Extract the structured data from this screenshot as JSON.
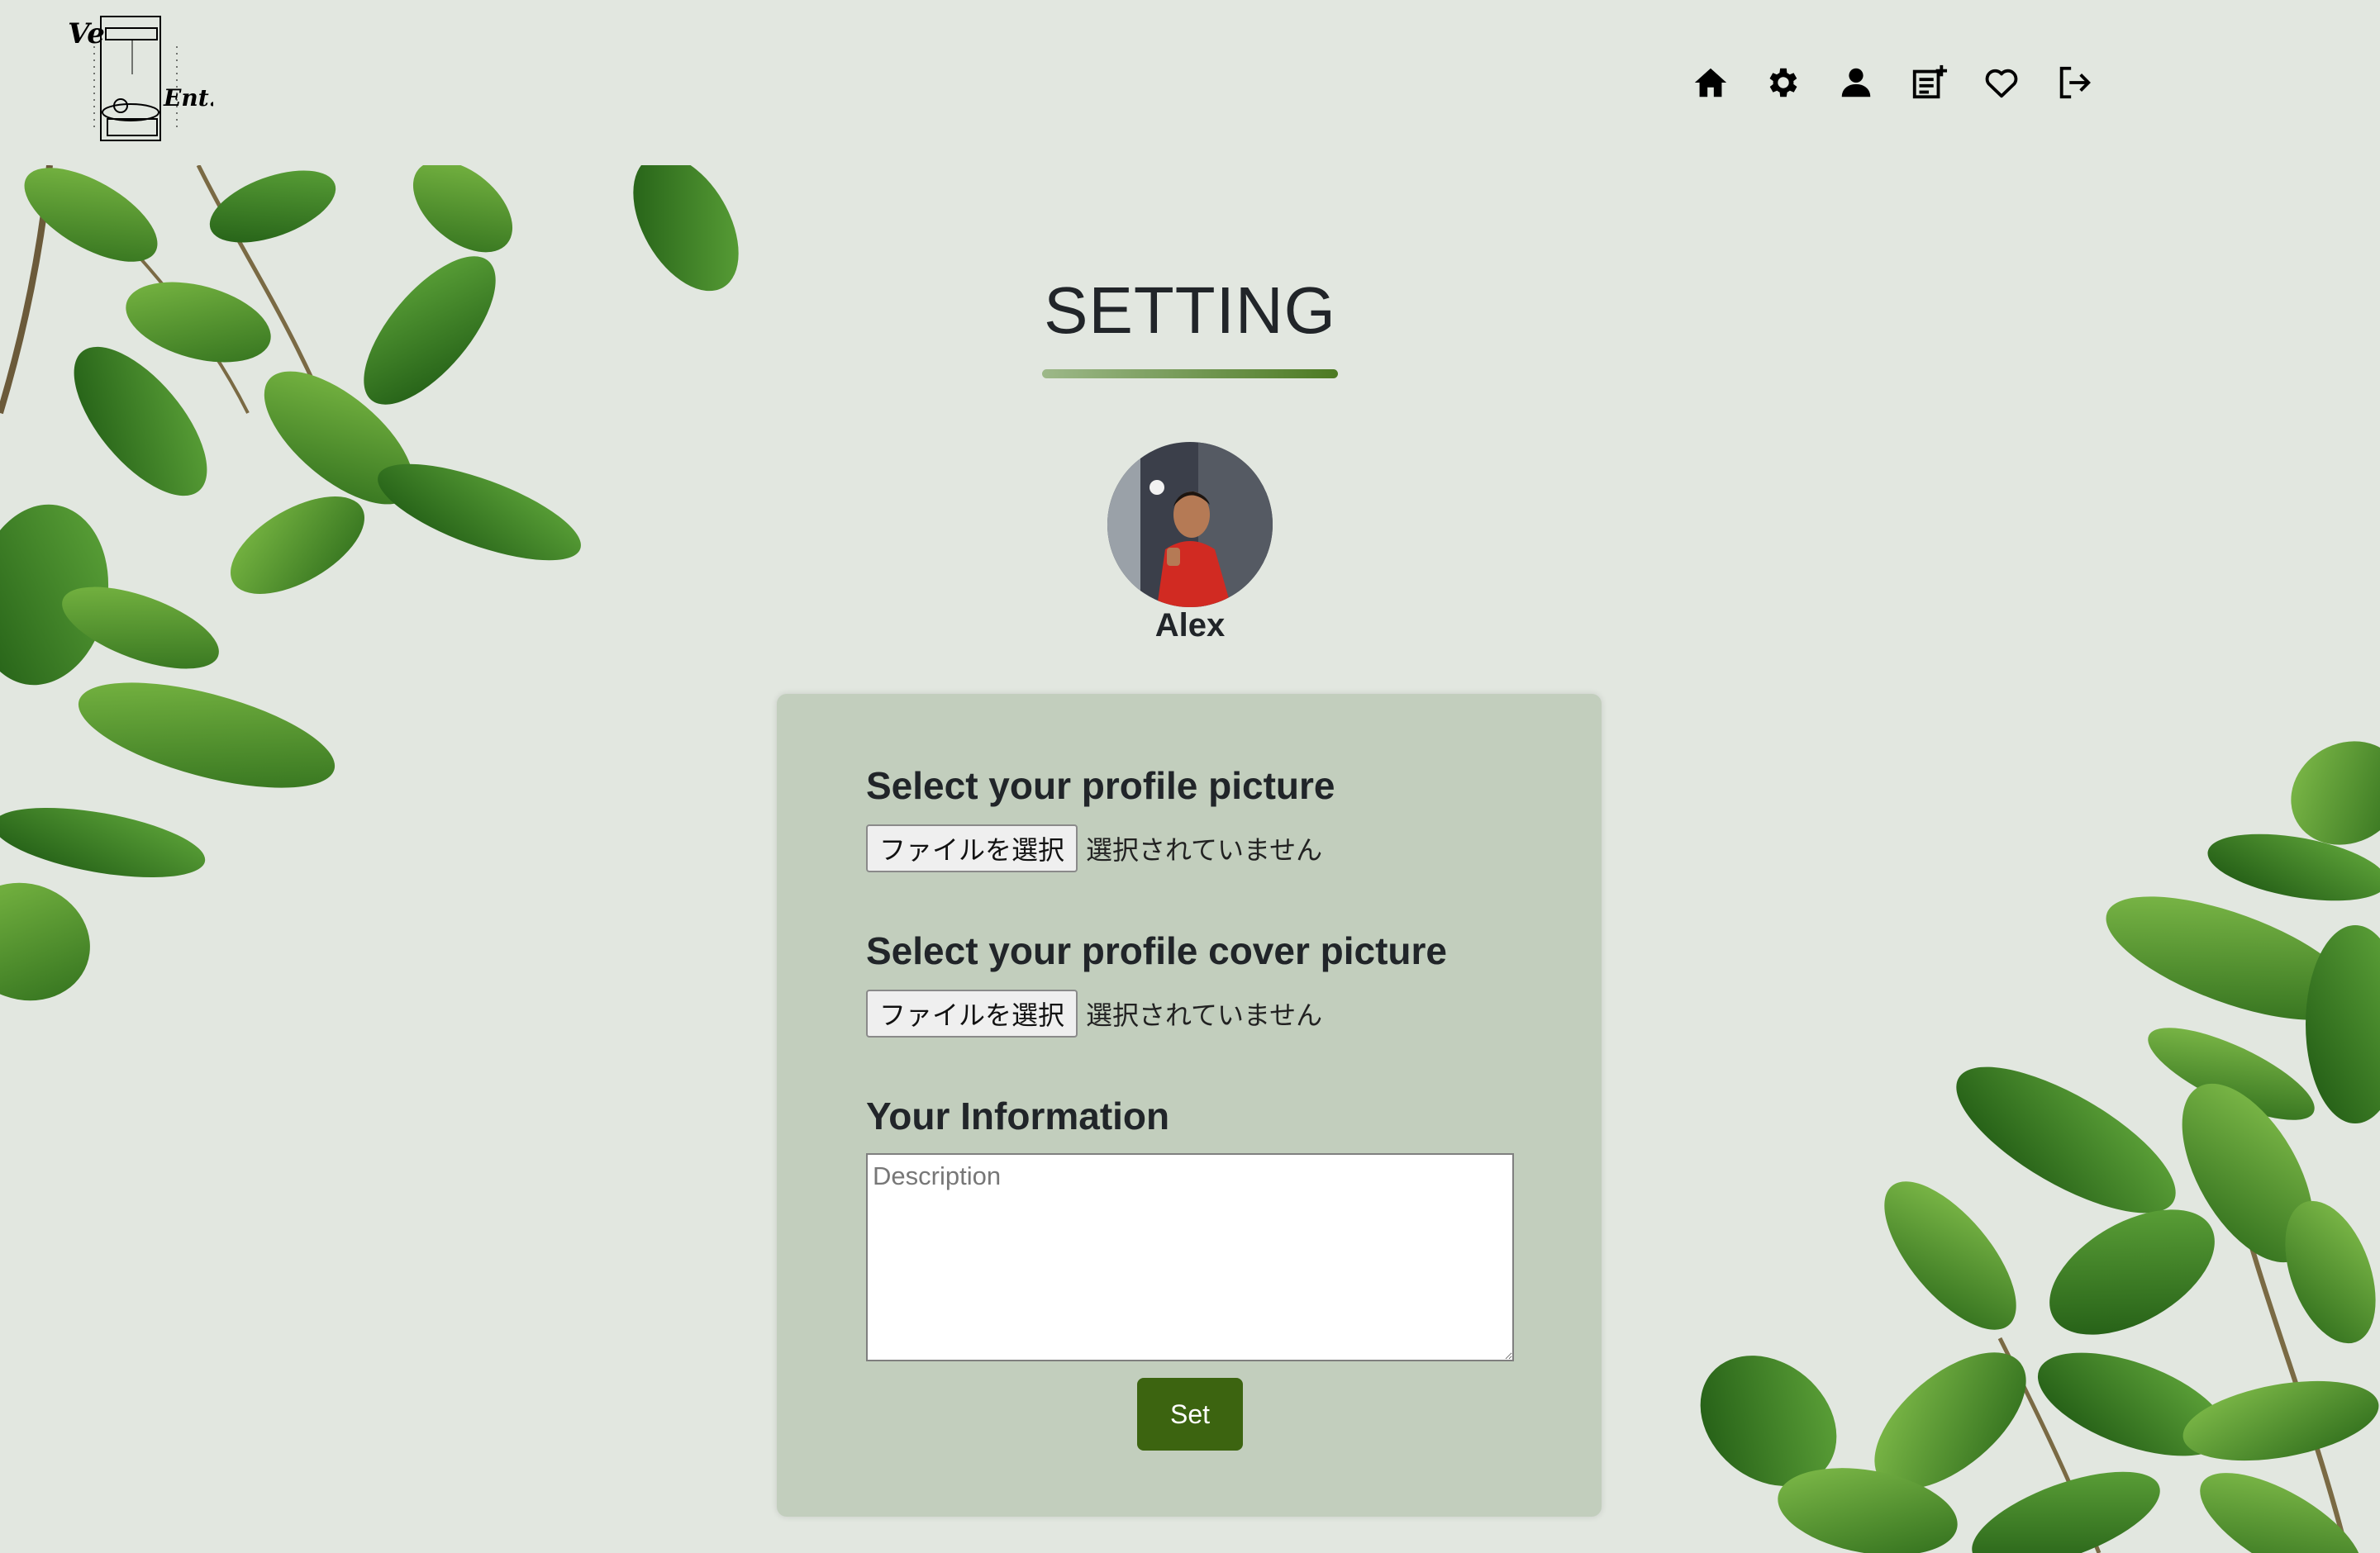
{
  "header": {
    "logo_alt": "Ve Ent. logo",
    "nav": [
      {
        "name": "home",
        "icon": "home-icon"
      },
      {
        "name": "settings",
        "icon": "gear-icon"
      },
      {
        "name": "profile",
        "icon": "user-icon"
      },
      {
        "name": "add-post",
        "icon": "add-post-icon"
      },
      {
        "name": "favorites",
        "icon": "heart-icon"
      },
      {
        "name": "logout",
        "icon": "logout-icon"
      }
    ]
  },
  "page": {
    "title": "SETTING"
  },
  "profile": {
    "username": "Alex"
  },
  "form": {
    "profile_picture_label": "Select your profile picture",
    "cover_picture_label": "Select your profile cover picture",
    "file_button_label": "ファイルを選択",
    "file_status": "選択されていません",
    "info_label": "Your Information",
    "description_placeholder": "Description",
    "submit_label": "Set"
  },
  "colors": {
    "background": "#e2e7e0",
    "card": "#c2cebd",
    "accent": "#3c6410"
  }
}
